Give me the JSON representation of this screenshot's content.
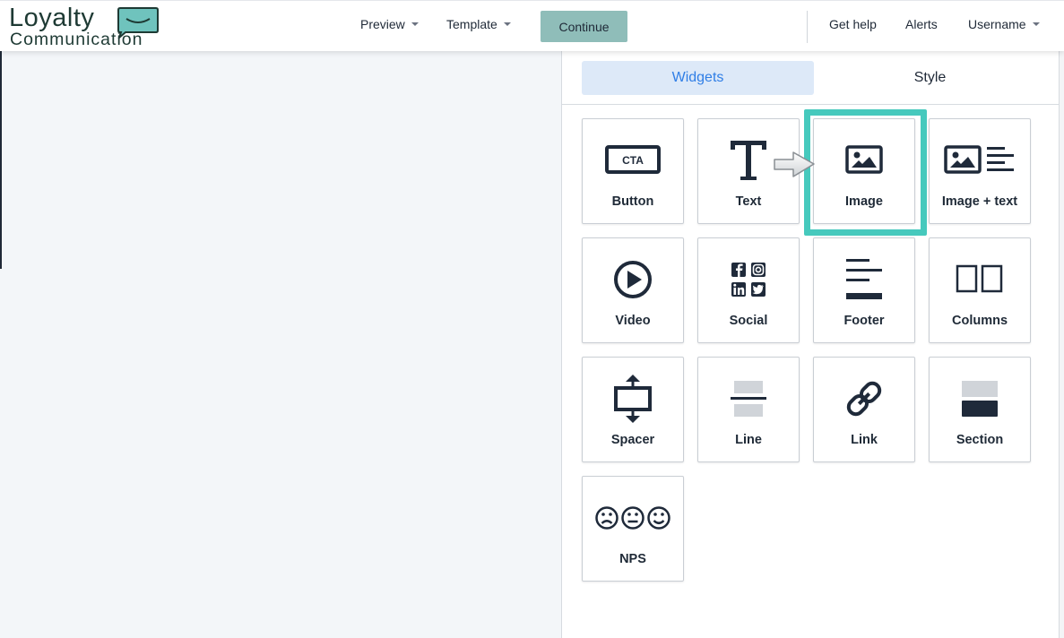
{
  "app": {
    "logo_line1": "Loyalty",
    "logo_line2": "Communication"
  },
  "header": {
    "preview_label": "Preview",
    "template_label": "Template",
    "continue_label": "Continue",
    "help_label": "Get help",
    "alerts_label": "Alerts",
    "user_label": "Username"
  },
  "panel": {
    "tabs": [
      {
        "label": "Widgets",
        "active": true
      },
      {
        "label": "Style",
        "active": false
      }
    ],
    "widgets": [
      {
        "label": "Button",
        "icon": "cta-icon"
      },
      {
        "label": "Text",
        "icon": "text-icon"
      },
      {
        "label": "Image",
        "icon": "image-icon",
        "highlighted": true
      },
      {
        "label": "Image + text",
        "icon": "image-text-icon"
      },
      {
        "label": "Video",
        "icon": "play-icon"
      },
      {
        "label": "Social",
        "icon": "social-icon"
      },
      {
        "label": "Footer",
        "icon": "footer-icon"
      },
      {
        "label": "Columns",
        "icon": "columns-icon"
      },
      {
        "label": "Spacer",
        "icon": "spacer-icon"
      },
      {
        "label": "Line",
        "icon": "line-icon"
      },
      {
        "label": "Link",
        "icon": "link-icon"
      },
      {
        "label": "Section",
        "icon": "section-icon"
      },
      {
        "label": "NPS",
        "icon": "nps-icon"
      }
    ],
    "cta_icon_text": "CTA"
  },
  "colors": {
    "accent_blue": "#2f7ee6",
    "tab_active_bg": "#dde9f8",
    "continue_bg": "#8fbdb9",
    "highlight": "#46c9bd",
    "icon_dark": "#1f2a3a",
    "canvas_bg": "#f3f6f9"
  }
}
